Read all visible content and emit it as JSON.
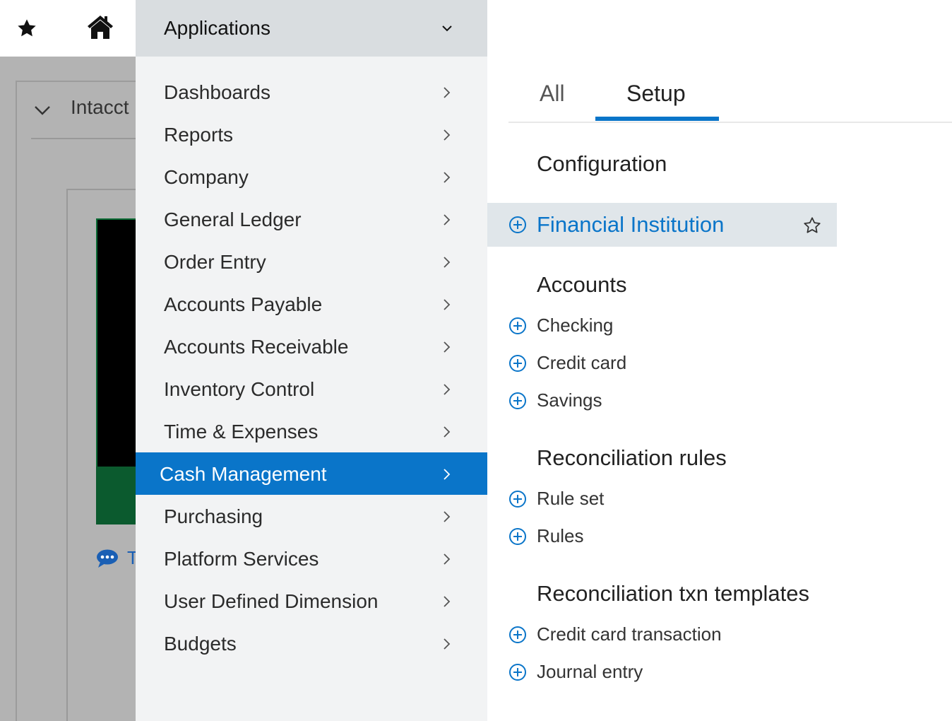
{
  "topbar": {
    "star_icon": "star-icon",
    "home_icon": "home-icon"
  },
  "background": {
    "card_title": "Intacct",
    "chat_text": "T"
  },
  "applications": {
    "header_label": "Applications",
    "items": [
      {
        "label": "Dashboards"
      },
      {
        "label": "Reports"
      },
      {
        "label": "Company"
      },
      {
        "label": "General Ledger"
      },
      {
        "label": "Order Entry"
      },
      {
        "label": "Accounts Payable"
      },
      {
        "label": "Accounts Receivable"
      },
      {
        "label": "Inventory Control"
      },
      {
        "label": "Time & Expenses"
      },
      {
        "label": "Cash Management",
        "active": true
      },
      {
        "label": "Purchasing"
      },
      {
        "label": "Platform Services"
      },
      {
        "label": "User Defined Dimension"
      },
      {
        "label": "Budgets"
      }
    ]
  },
  "panel": {
    "tabs": [
      {
        "label": "All"
      },
      {
        "label": "Setup",
        "selected": true
      }
    ],
    "sections": {
      "configuration": {
        "title": "Configuration",
        "links": [
          {
            "label": "Financial Institution",
            "highlighted": true
          }
        ]
      },
      "accounts": {
        "title": "Accounts",
        "links": [
          {
            "label": "Checking"
          },
          {
            "label": "Credit card"
          },
          {
            "label": "Savings"
          }
        ]
      },
      "reconciliation_rules": {
        "title": "Reconciliation rules",
        "links": [
          {
            "label": "Rule set"
          },
          {
            "label": "Rules"
          }
        ]
      },
      "reconciliation_txn_templates": {
        "title": "Reconciliation txn templates",
        "links": [
          {
            "label": "Credit card transaction"
          },
          {
            "label": "Journal entry"
          }
        ]
      }
    }
  },
  "colors": {
    "accent": "#0a75c9",
    "menu_bg": "#f2f3f4",
    "header_bg": "#d9dde0",
    "highlight_bg": "#e0e6ea"
  }
}
